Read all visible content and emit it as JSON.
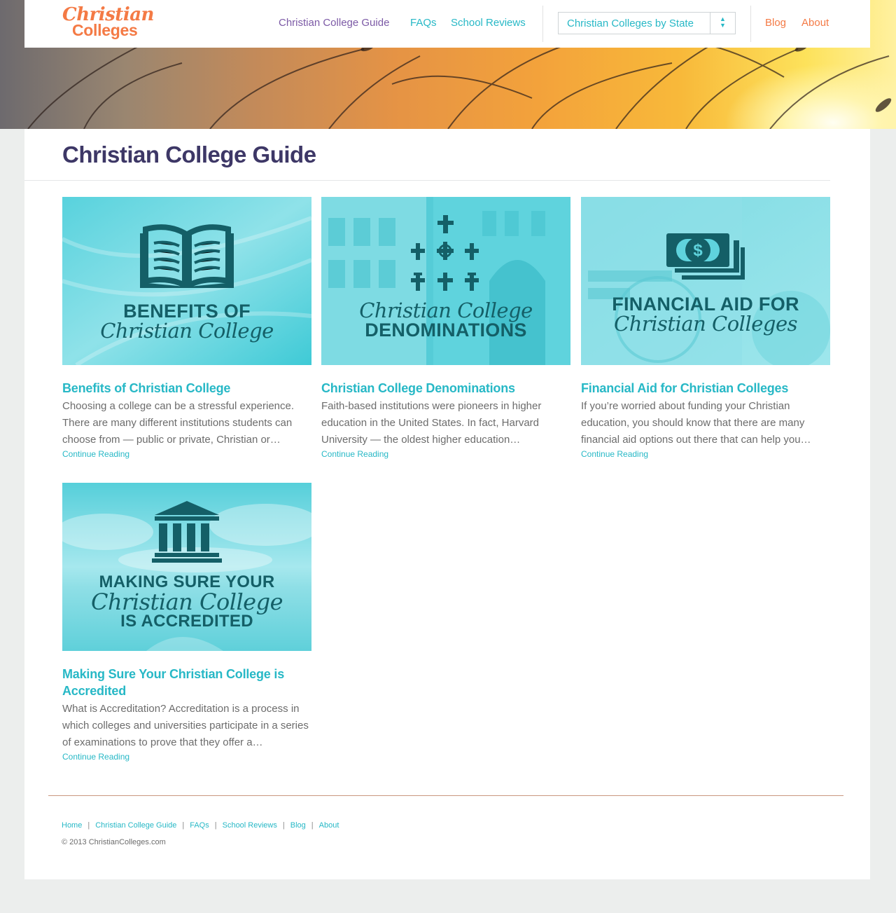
{
  "site": {
    "logo_line1": "Christian",
    "logo_line2": "Colleges"
  },
  "nav": {
    "guide": "Christian College Guide",
    "faqs": "FAQs",
    "reviews": "School Reviews",
    "state_select": "Christian Colleges by State",
    "blog": "Blog",
    "about": "About"
  },
  "page": {
    "title": "Christian College Guide"
  },
  "articles": [
    {
      "image_line1": "BENEFITS OF",
      "image_line2": "Christian College",
      "image_icon": "open-book-icon",
      "title": "Benefits of Christian College",
      "excerpt": "Choosing a college can be a stressful experience. There are many different institutions students can choose from — public or private, Christian or…",
      "more": "Continue Reading"
    },
    {
      "image_line1": "Christian College",
      "image_line2": "DENOMINATIONS",
      "image_icon": "crosses-icon",
      "title": "Christian College Denominations",
      "excerpt": "Faith-based institutions were pioneers in higher education in the United States. In fact, Harvard University — the oldest higher education…",
      "more": "Continue Reading"
    },
    {
      "image_line1": "FINANCIAL AID FOR",
      "image_line2": "Christian Colleges",
      "image_icon": "money-stack-icon",
      "title": "Financial Aid for Christian Colleges",
      "excerpt": "If you’re worried about funding your Christian education, you should know that there are many financial aid options out there that can help you…",
      "more": "Continue Reading"
    },
    {
      "image_line1": "MAKING SURE YOUR",
      "image_line2": "Christian College",
      "image_line3": "IS ACCREDITED",
      "image_icon": "institution-building-icon",
      "title": "Making Sure Your Christian College is Accredited",
      "excerpt": "What is Accreditation? Accreditation is a process in which colleges and universities participate in a series of examinations to prove that they offer a…",
      "more": "Continue Reading"
    }
  ],
  "footer": {
    "links": [
      "Home",
      "Christian College Guide",
      "FAQs",
      "School Reviews",
      "Blog",
      "About"
    ],
    "copyright": "© 2013 ChristianColleges.com"
  },
  "colors": {
    "accent_teal": "#27b8c6",
    "accent_orange": "#f47a45",
    "accent_purple": "#7c5aa6",
    "title_navy": "#3d3766"
  }
}
